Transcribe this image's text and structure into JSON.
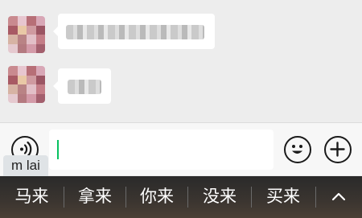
{
  "input": {
    "value": "",
    "pinyin_preview": "m lai"
  },
  "candidates": [
    "马来",
    "拿来",
    "你来",
    "没来",
    "买来"
  ],
  "icons": {
    "voice": "voice-wave-icon",
    "emoji": "smiley-face-icon",
    "more": "plus-icon",
    "expand": "chevron-up-icon"
  },
  "colors": {
    "chat_background": "#ededed",
    "bubble": "#ffffff",
    "caret": "#07c160",
    "candidate_bar": "#2a2a2a"
  }
}
